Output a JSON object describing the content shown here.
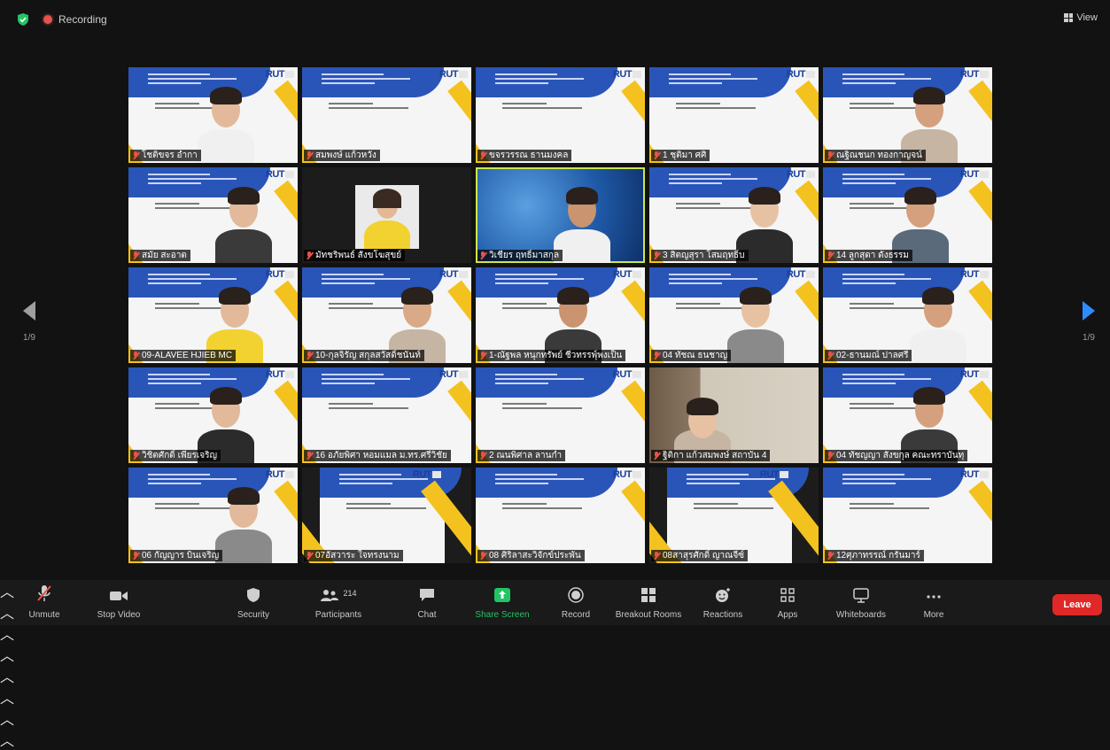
{
  "topbar": {
    "recording_label": "Recording",
    "view_label": "View"
  },
  "pagination": {
    "left": "1/9",
    "right": "1/9"
  },
  "participants": [
    {
      "name": "โชติขจร อำกา",
      "tile": "slide-person",
      "active": false
    },
    {
      "name": "สมพงษ์ แก้วหวัง",
      "tile": "slide",
      "active": false
    },
    {
      "name": "ขจรวรรณ ธานมงคล",
      "tile": "slide",
      "active": false
    },
    {
      "name": "1 ชุติมา ศศิ",
      "tile": "slide",
      "active": false
    },
    {
      "name": "ณฐิณชนก ทองกาญจน์",
      "tile": "slide-person",
      "active": false
    },
    {
      "name": "สมัย สะอาด",
      "tile": "slide-person",
      "active": false
    },
    {
      "name": "มัทชริพนธ์ สังขโฆสุขย์",
      "tile": "photo",
      "active": false
    },
    {
      "name": "วิเชียร ฤทธิ์มาสกุล",
      "tile": "camera-blue",
      "active": true
    },
    {
      "name": "3 สิตญสุรา โสมฤทธิ์บ",
      "tile": "slide-person",
      "active": false
    },
    {
      "name": "14 ลูกสุดา ดังธรรม",
      "tile": "slide-person",
      "active": false
    },
    {
      "name": "09-ALAVEE HJIEB MC",
      "tile": "slide-person",
      "active": false
    },
    {
      "name": "10-กุลจิรัญ สกุลสวัสดิ์ชนันท์",
      "tile": "slide-person",
      "active": false
    },
    {
      "name": "1-ณัฐพล หนุกทรัพย์ ชีวทรรพุ์พงเป็น",
      "tile": "slide-person",
      "active": false
    },
    {
      "name": "04 ทัชณ ธนชาญ",
      "tile": "slide-person",
      "active": false
    },
    {
      "name": "02-ธานมณ์ ปาลศรี",
      "tile": "slide-person",
      "active": false
    },
    {
      "name": "วิชิตศักดิ์ เพียรเจริญ",
      "tile": "slide-person",
      "active": false
    },
    {
      "name": "16 อภัยพิศา หอมแมล ม.ทร.ศรีวิชัย",
      "tile": "slide",
      "active": false
    },
    {
      "name": "2 ณนพิศาล ลานกำ",
      "tile": "slide",
      "active": false
    },
    {
      "name": "ฐิติกา แก้วสมพงษ์ สถาบัน 4",
      "tile": "camera-office",
      "active": false
    },
    {
      "name": "04 ทัชญญา สังขกุล คณะทราบันทุ",
      "tile": "slide-person",
      "active": false
    },
    {
      "name": "06 กัญญาร บินเจริญ",
      "tile": "slide-person",
      "active": false
    },
    {
      "name": "07อัสวาระ ใจทรงนาม",
      "tile": "slide-narrow",
      "active": false
    },
    {
      "name": "08 ศิริลาสะวิจักข์ประพัน",
      "tile": "slide",
      "active": false
    },
    {
      "name": "08สาสุรศักดิ์ ญาณจีซ์",
      "tile": "slide-narrow",
      "active": false
    },
    {
      "name": "12ศุภาทรรณ์ กรันมาร์",
      "tile": "slide",
      "active": false
    }
  ],
  "toolbar": {
    "unmute": "Unmute",
    "stop_video": "Stop Video",
    "security": "Security",
    "participants": "Participants",
    "participants_count": "214",
    "chat": "Chat",
    "share_screen": "Share Screen",
    "record": "Record",
    "breakout_rooms": "Breakout Rooms",
    "reactions": "Reactions",
    "apps": "Apps",
    "whiteboards": "Whiteboards",
    "more": "More",
    "leave": "Leave"
  },
  "slide_logo": "RUT",
  "colors": {
    "share_green": "#23c464",
    "leave_red": "#e02828",
    "active_outline": "#cde64b",
    "nav_blue": "#2d8cff"
  }
}
